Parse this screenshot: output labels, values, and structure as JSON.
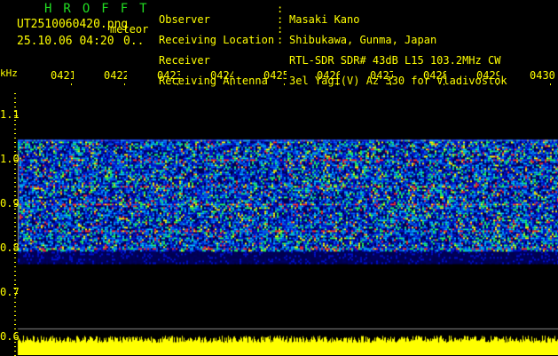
{
  "header": {
    "app_title": "HROFFT",
    "filename": "UT2510060420.png",
    "mode": "meteor",
    "datetime": "25.10.06 04:20",
    "duration": "0.."
  },
  "info": {
    "labels": [
      "Observer",
      "Receiving Location",
      "Receiver",
      "Receiving Antenna"
    ],
    "values": [
      "Masaki Kano",
      "Shibukawa, Gunma, Japan",
      "RTL-SDR SDR# 43dB L15 103.2MHz CW",
      "3el Yagi(V) Az 330 for Vladivostok"
    ]
  },
  "chart_data": {
    "type": "heatmap",
    "ylabel": "kHz",
    "x_ticks": [
      "0421",
      "0422",
      "0423",
      "0424",
      "0425",
      "0426",
      "0427",
      "0428",
      "0429",
      "0430"
    ],
    "y_ticks": [
      "1.1",
      "1.0",
      "0.9",
      "0.8",
      "0.7",
      "0.6"
    ],
    "ylim": [
      0.56,
      1.16
    ],
    "signal_band_khz": [
      0.765,
      1.045
    ],
    "strong_lines_khz": [
      1.0,
      0.94,
      0.9,
      0.84,
      0.8
    ],
    "colors": {
      "text": "#ffff00",
      "title": "#22dd22",
      "background": "#000000",
      "level_bar": "#ffff00"
    }
  }
}
